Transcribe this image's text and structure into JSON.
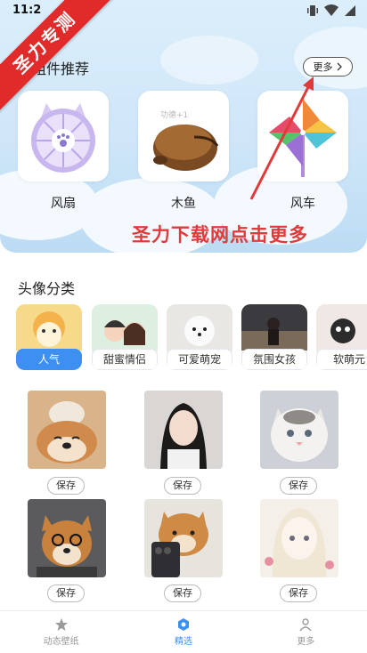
{
  "status_bar": {
    "time": "11:2"
  },
  "ribbon": {
    "text": "圣力专测"
  },
  "widgets": {
    "title": "组件推荐",
    "more_label": "更多",
    "items": [
      {
        "label": "风扇",
        "icon": "fan-icon"
      },
      {
        "label": "木鱼",
        "icon": "wooden-fish-icon",
        "overlay_text": "功德+1"
      },
      {
        "label": "风车",
        "icon": "pinwheel-icon"
      }
    ]
  },
  "promo_text": "圣力下载网点击更多",
  "avatar_section": {
    "title": "头像分类",
    "categories": [
      {
        "label": "人气",
        "active": true
      },
      {
        "label": "甜蜜情侣",
        "active": false
      },
      {
        "label": "可爱萌宠",
        "active": false
      },
      {
        "label": "氛围女孩",
        "active": false
      },
      {
        "label": "软萌元",
        "active": false
      }
    ],
    "save_label": "保存"
  },
  "bottom_nav": [
    {
      "label": "动态壁纸",
      "icon": "star-icon",
      "active": false
    },
    {
      "label": "精选",
      "icon": "hexagon-icon",
      "active": true
    },
    {
      "label": "更多",
      "icon": "person-icon",
      "active": false
    }
  ],
  "colors": {
    "accent": "#3d8ff2",
    "promo": "#e13a3a",
    "ribbon": "#e12b2b",
    "hero": "#cfe6f8"
  }
}
